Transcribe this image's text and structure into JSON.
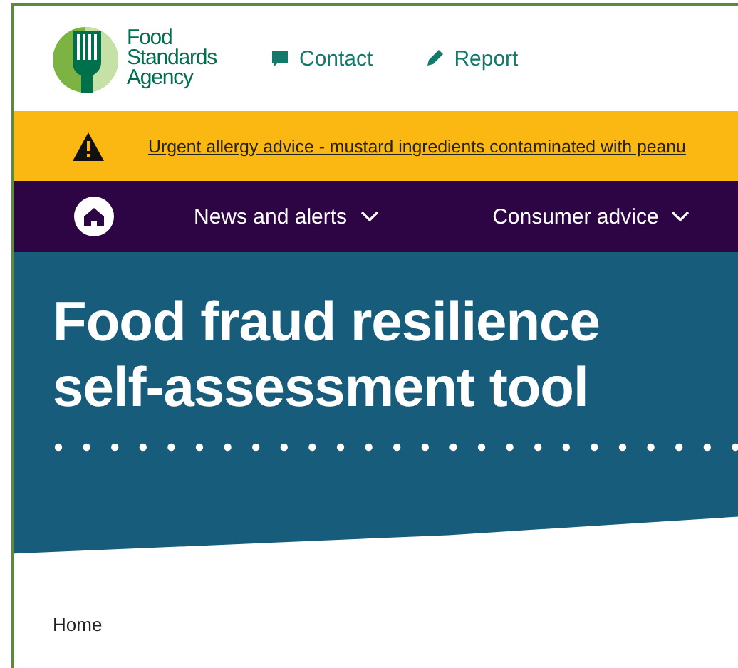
{
  "header": {
    "brand_lines": [
      "Food",
      "Standards",
      "Agency"
    ],
    "links": [
      {
        "label": "Contact",
        "kind": "contact"
      },
      {
        "label": "Report",
        "kind": "report"
      }
    ]
  },
  "alert": {
    "text": "Urgent allergy advice - mustard ingredients contaminated with peanu"
  },
  "nav": {
    "items": [
      {
        "label": "News and alerts",
        "expanded": false
      },
      {
        "label": "Consumer advice",
        "expanded": false
      }
    ]
  },
  "hero": {
    "title_lines": [
      "Food fraud resilience",
      "self-assessment tool"
    ]
  },
  "breadcrumb": [
    "Home"
  ]
}
